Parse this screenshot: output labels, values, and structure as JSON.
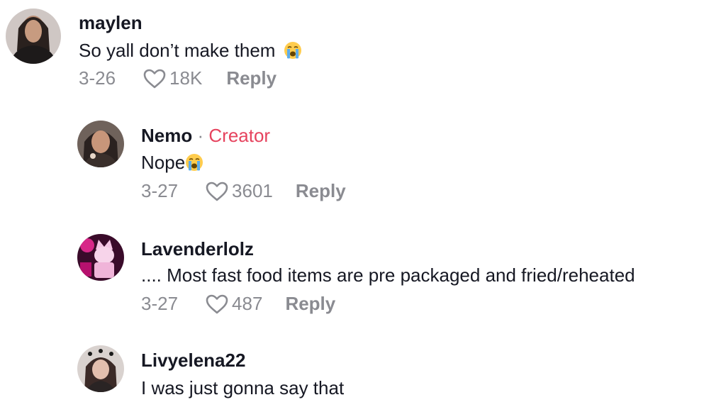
{
  "comments": [
    {
      "username": "maylen",
      "text": "So yall don’t make them",
      "date": "3-26",
      "likes": "18K",
      "reply_label": "Reply",
      "emoji": "loudly-crying-face"
    },
    {
      "username": "Nemo",
      "creator_separator": "·",
      "creator_label": "Creator",
      "text": "Nope",
      "date": "3-27",
      "likes": "3601",
      "reply_label": "Reply",
      "emoji": "loudly-crying-face"
    },
    {
      "username": "Lavenderlolz",
      "text": ".... Most fast food items are pre packaged and fried/reheated",
      "date": "3-27",
      "likes": "487",
      "reply_label": "Reply"
    },
    {
      "username": "Livyelena22",
      "text": "I was just gonna say that"
    }
  ],
  "colors": {
    "creator": "#e6435e",
    "meta": "#8a8b91",
    "text": "#161823"
  },
  "icons": {
    "like": "heart-outline-icon"
  }
}
